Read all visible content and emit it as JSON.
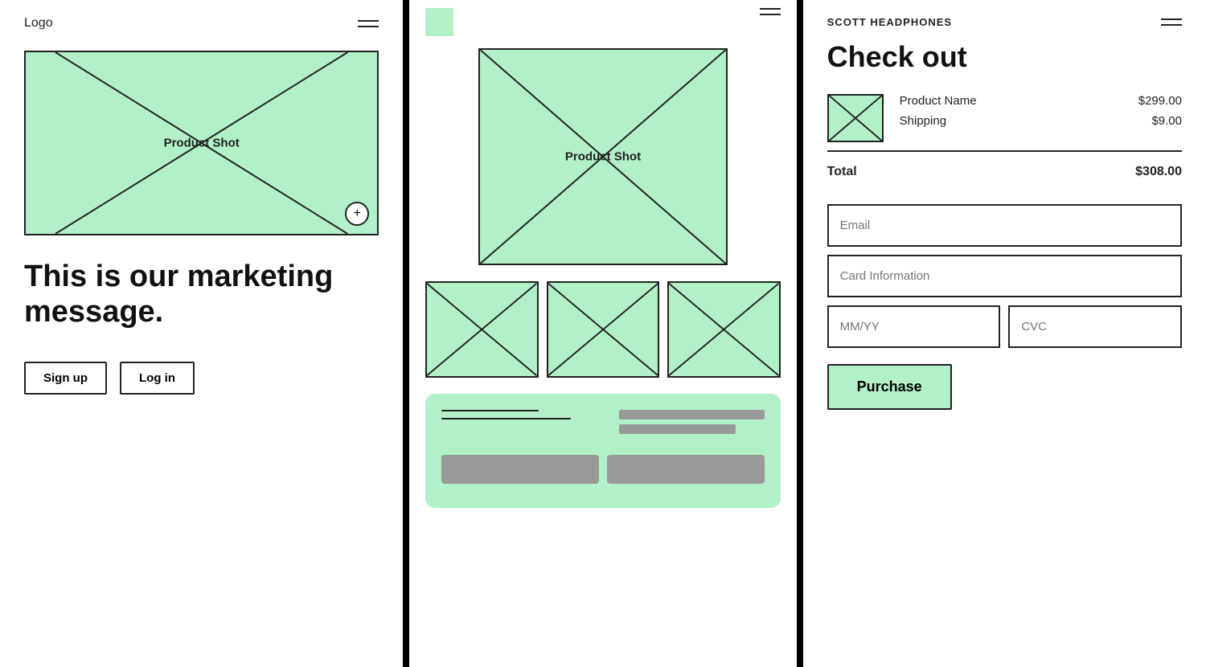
{
  "panel1": {
    "logo": "Logo",
    "marketing_text": "This is our marketing message.",
    "product_label": "Product Shot",
    "sign_up_label": "Sign up",
    "log_in_label": "Log in"
  },
  "panel2": {
    "product_label": "Product Shot"
  },
  "panel3": {
    "brand": "SCOTT HEADPHONES",
    "checkout_title": "Check out",
    "product_name": "Product Name",
    "product_price": "$299.00",
    "shipping_label": "Shipping",
    "shipping_price": "$9.00",
    "total_label": "Total",
    "total_price": "$308.00",
    "email_placeholder": "Email",
    "card_placeholder": "Card Information",
    "mmyy_placeholder": "MM/YY",
    "cvc_placeholder": "CVC",
    "purchase_label": "Purchase"
  }
}
